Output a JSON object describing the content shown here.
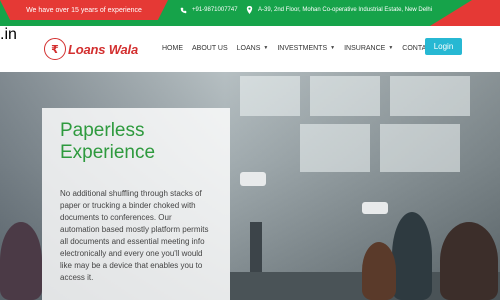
{
  "topbar": {
    "experience_text": "We have over 15 years of experience",
    "phone": "+91-9871007747",
    "address": "A-39, 2nd Floor, Mohan Co-operative Industrial Estate, New Delhi",
    "icons": {
      "phone": "phone-icon",
      "location": "location-pin-icon"
    },
    "colors": {
      "green": "#16a34a",
      "red": "#e53935"
    }
  },
  "header": {
    "logo_word": "Loans Wala",
    "logo_tld": ".in",
    "nav": [
      {
        "label": "HOME",
        "dropdown": false
      },
      {
        "label": "ABOUT US",
        "dropdown": false
      },
      {
        "label": "LOANS",
        "dropdown": true
      },
      {
        "label": "INVESTMENTS",
        "dropdown": true
      },
      {
        "label": "INSURANCE",
        "dropdown": true
      },
      {
        "label": "CONTACT US",
        "dropdown": false
      }
    ],
    "login_label": "Login",
    "login_color": "#27b8d3"
  },
  "hero": {
    "title": "Paperless Experience",
    "description": "No additional shuffling through stacks of paper or trucking a binder choked with documents to conferences. Our automation based mostly platform permits all documents and essential meeting info electronically and every one you'll would like may be a device that enables you to access it.",
    "title_color": "#2e9a3e"
  }
}
